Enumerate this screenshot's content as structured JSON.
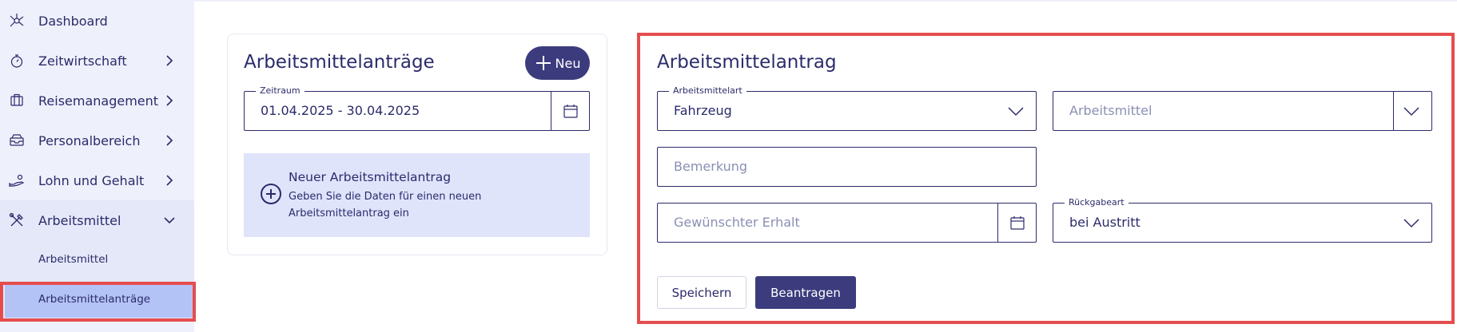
{
  "sidebar": {
    "items": [
      {
        "label": "Dashboard",
        "icon": "dashboard-icon"
      },
      {
        "label": "Zeitwirtschaft",
        "icon": "stopwatch-icon"
      },
      {
        "label": "Reisemanagement",
        "icon": "travel-icon"
      },
      {
        "label": "Personalbereich",
        "icon": "inbox-icon"
      },
      {
        "label": "Lohn und Gehalt",
        "icon": "salary-icon"
      },
      {
        "label": "Arbeitsmittel",
        "icon": "tools-icon"
      }
    ],
    "subitems": [
      {
        "label": "Arbeitsmittel"
      },
      {
        "label": "Arbeitsmittelanträge"
      }
    ]
  },
  "list_panel": {
    "title": "Arbeitsmittelanträge",
    "new_button": "Neu",
    "period_label": "Zeitraum",
    "period_value": "01.04.2025 - 30.04.2025",
    "info_title": "Neuer Arbeitsmittelantrag",
    "info_text": "Geben Sie die Daten für einen neuen Arbeitsmittelantrag ein"
  },
  "form": {
    "title": "Arbeitsmittelantrag",
    "type_label": "Arbeitsmittelart",
    "type_value": "Fahrzeug",
    "item_placeholder": "Arbeitsmittel",
    "remark_placeholder": "Bemerkung",
    "desired_placeholder": "Gewünschter Erhalt",
    "return_label": "Rückgabeart",
    "return_value": "bei Austritt",
    "save_label": "Speichern",
    "apply_label": "Beantragen"
  },
  "colors": {
    "accent": "#3b3b7d",
    "text": "#2b2b6b",
    "sidebar_bg": "#eef0fb",
    "active_bg": "#b4c3f6",
    "info_bg": "#dfe4fb",
    "highlight": "#e54d4d"
  }
}
